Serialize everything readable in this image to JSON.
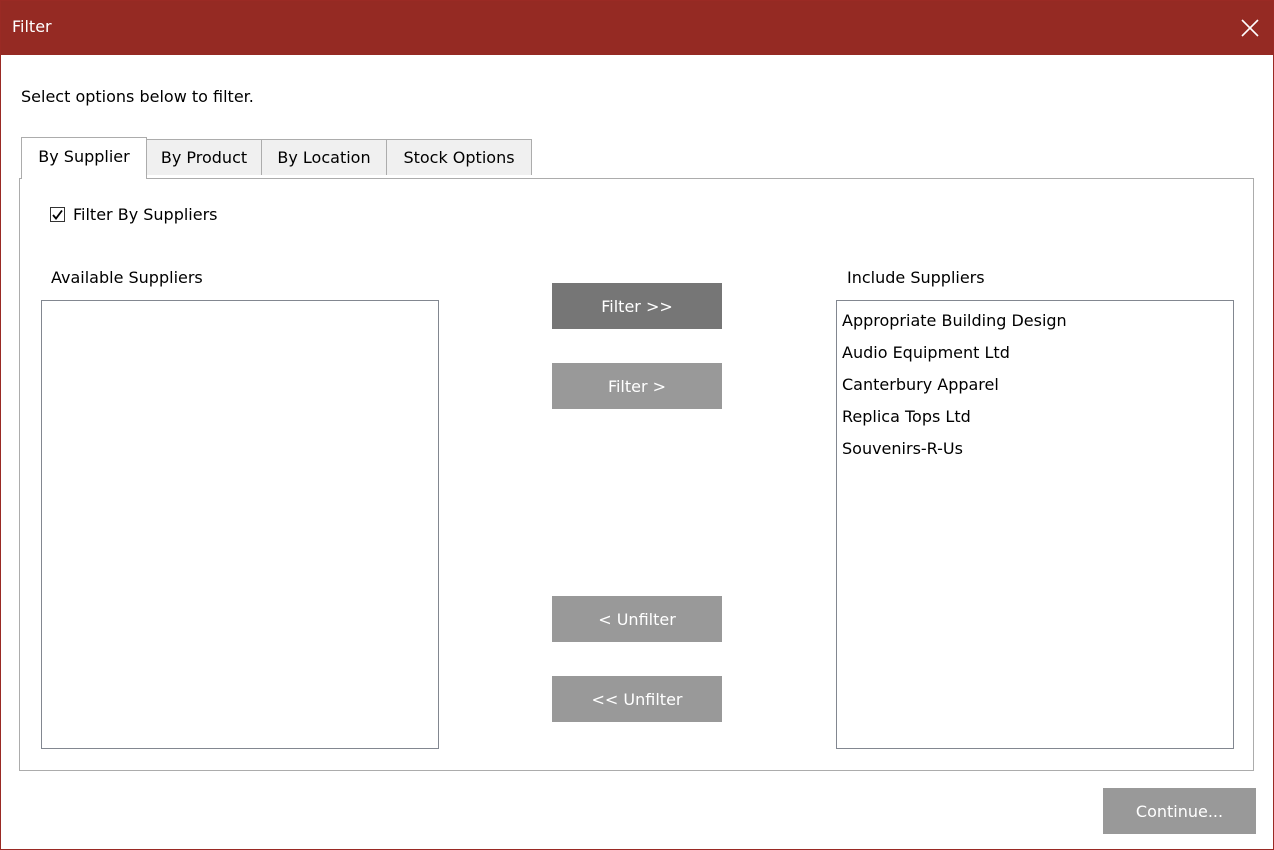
{
  "window": {
    "title": "Filter",
    "close_icon": "close-icon"
  },
  "instruction": "Select options below to filter.",
  "tabs": [
    {
      "label": "By Supplier",
      "active": true
    },
    {
      "label": "By Product",
      "active": false
    },
    {
      "label": "By Location",
      "active": false
    },
    {
      "label": "Stock Options",
      "active": false
    }
  ],
  "supplier_tab": {
    "filter_checkbox": {
      "label": "Filter By Suppliers",
      "checked": true
    },
    "available_label": "Available Suppliers",
    "available_items": [],
    "include_label": "Include Suppliers",
    "include_items": [
      "Appropriate Building Design",
      "Audio Equipment Ltd",
      "Canterbury Apparel",
      "Replica Tops Ltd",
      "Souvenirs-R-Us"
    ],
    "buttons": {
      "filter_all": "Filter >>",
      "filter_one": "Filter >",
      "unfilter_one": "< Unfilter",
      "unfilter_all": "<< Unfilter"
    }
  },
  "footer": {
    "continue_label": "Continue..."
  },
  "colors": {
    "titlebar": "#952a23",
    "button_dark": "#767676",
    "button_light": "#999999"
  }
}
